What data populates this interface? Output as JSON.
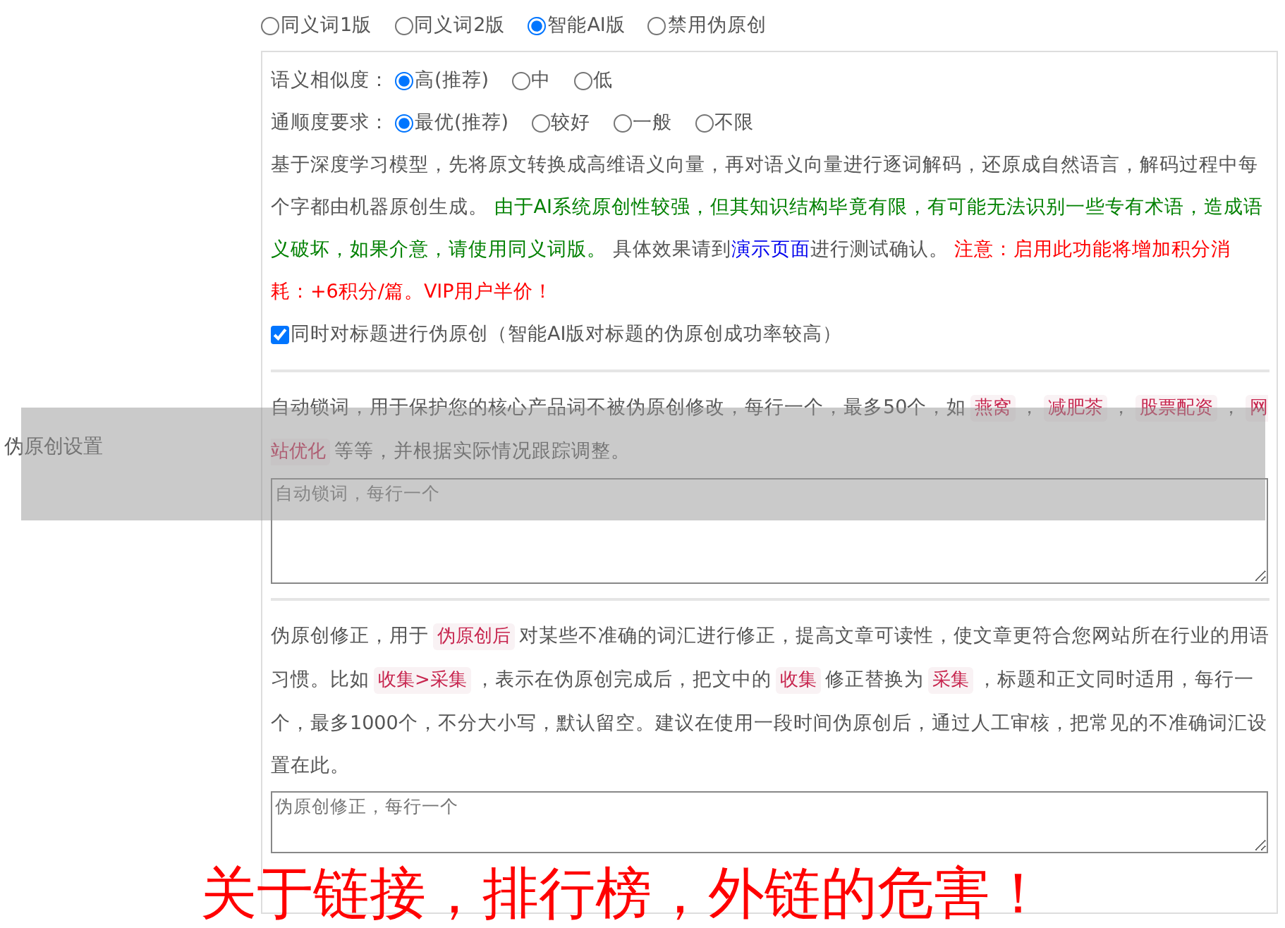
{
  "section_label": "伪原创设置",
  "mode_options": [
    {
      "label": "同义词1版",
      "selected": false
    },
    {
      "label": "同义词2版",
      "selected": false
    },
    {
      "label": "智能AI版",
      "selected": true
    },
    {
      "label": "禁用伪原创",
      "selected": false
    }
  ],
  "similarity": {
    "label": "语义相似度：",
    "options": [
      {
        "label": "高(推荐)",
        "selected": true
      },
      {
        "label": "中",
        "selected": false
      },
      {
        "label": "低",
        "selected": false
      }
    ]
  },
  "fluency": {
    "label": "通顺度要求：",
    "options": [
      {
        "label": "最优(推荐)",
        "selected": true
      },
      {
        "label": "较好",
        "selected": false
      },
      {
        "label": "一般",
        "selected": false
      },
      {
        "label": "不限",
        "selected": false
      }
    ]
  },
  "ai_description": [
    {
      "kind": "text",
      "text": "基于深度学习模型，先将原文转换成高维语义向量，再对语义向量进行逐词解码，还原成自然语言，解码过程中每个字都由机器原创生成。 "
    },
    {
      "kind": "note",
      "text": "由于AI系统原创性较强，但其知识结构毕竟有限，有可能无法识别一些专有术语，造成语义破坏，如果介意，请使用同义词版。"
    },
    {
      "kind": "text",
      "text": " 具体效果请到"
    },
    {
      "kind": "link",
      "text": "演示页面"
    },
    {
      "kind": "text",
      "text": "进行测试确认。 "
    },
    {
      "kind": "warning",
      "text": "注意：启用此功能将增加积分消耗：+6积分/篇。VIP用户半价！"
    }
  ],
  "title_checkbox": {
    "label": "同时对标题进行伪原创（智能AI版对标题的伪原创成功率较高）",
    "checked": true
  },
  "lock_words": {
    "description": [
      {
        "kind": "text",
        "text": "自动锁词，用于保护您的核心产品词不被伪原创修改，每行一个，最多50个，如"
      },
      {
        "kind": "code",
        "text": "燕窝"
      },
      {
        "kind": "text",
        "text": "，"
      },
      {
        "kind": "code",
        "text": "减肥茶"
      },
      {
        "kind": "text",
        "text": "，"
      },
      {
        "kind": "code",
        "text": "股票配资"
      },
      {
        "kind": "text",
        "text": "，"
      },
      {
        "kind": "code",
        "text": "网站优化"
      },
      {
        "kind": "text",
        "text": "等等，并根据实际情况跟踪调整。"
      }
    ],
    "placeholder": "自动锁词，每行一个"
  },
  "correction": {
    "description": [
      {
        "kind": "text",
        "text": "伪原创修正，用于"
      },
      {
        "kind": "code",
        "text": "伪原创后"
      },
      {
        "kind": "text",
        "text": "对某些不准确的词汇进行修正，提高文章可读性，使文章更符合您网站所在行业的用语习惯。比如"
      },
      {
        "kind": "code",
        "text": "收集>采集"
      },
      {
        "kind": "text",
        "text": "，表示在伪原创完成后，把文中的"
      },
      {
        "kind": "code",
        "text": "收集"
      },
      {
        "kind": "text",
        "text": "修正替换为"
      },
      {
        "kind": "code",
        "text": "采集"
      },
      {
        "kind": "text",
        "text": "，标题和正文同时适用，每行一个，最多1000个，不分大小写，默认留空。建议在使用一段时间伪原创后，通过人工审核，把常见的不准确词汇设置在此。"
      }
    ],
    "placeholder": "伪原创修正，每行一个"
  },
  "caption": "关于链接，排行榜，外链的危害！"
}
